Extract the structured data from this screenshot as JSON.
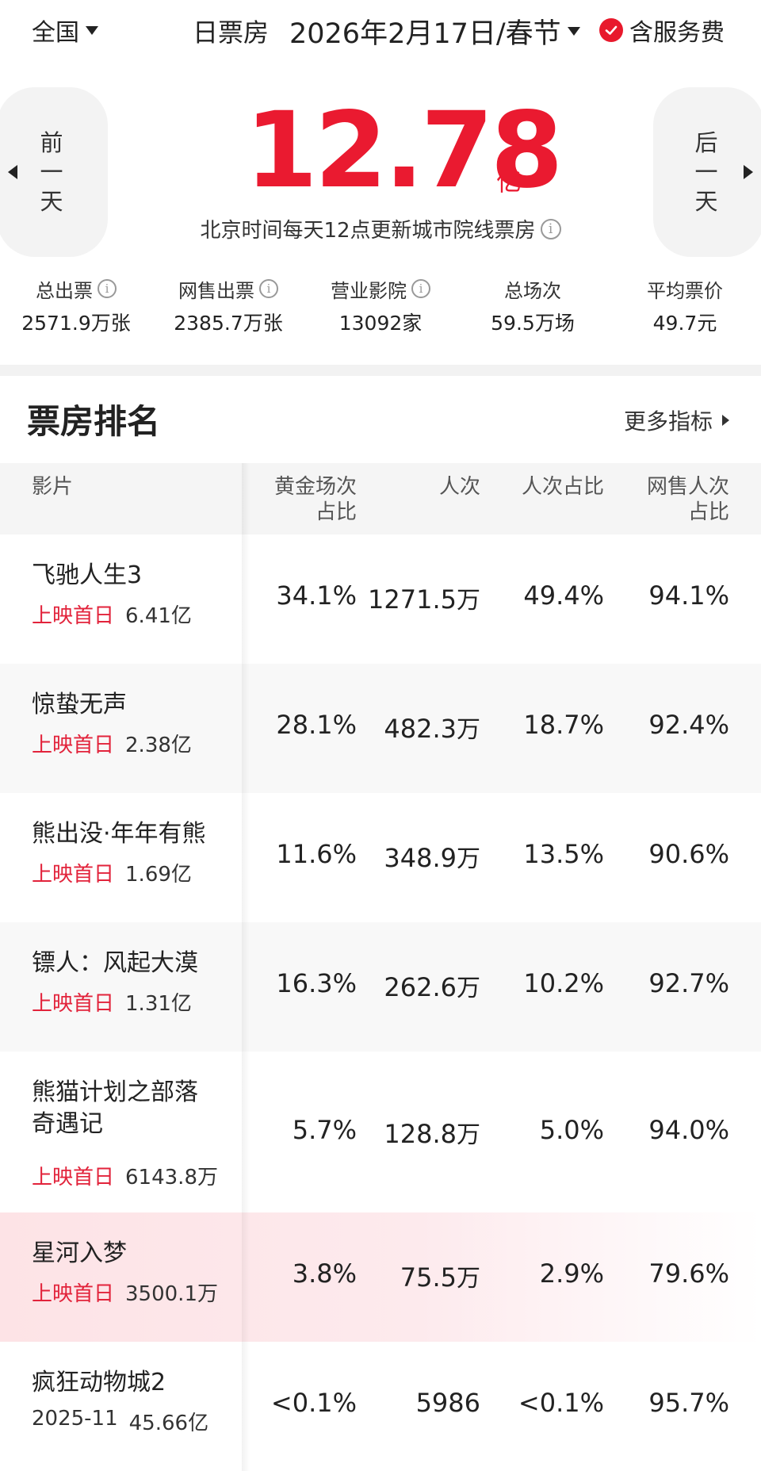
{
  "topbar": {
    "region": "全国",
    "title": "日票房",
    "date": "2026年2月17日/春节",
    "service_fee": "含服务费"
  },
  "hero": {
    "prev_label": [
      "前",
      "一",
      "天"
    ],
    "next_label": [
      "后",
      "一",
      "天"
    ],
    "box_office": "12.78",
    "box_office_unit": "亿",
    "update_note": "北京时间每天12点更新城市院线票房"
  },
  "stats": [
    {
      "label": "总出票",
      "value": "2571.9万张",
      "info": true
    },
    {
      "label": "网售出票",
      "value": "2385.7万张",
      "info": true
    },
    {
      "label": "营业影院",
      "value": "13092家",
      "info": true
    },
    {
      "label": "总场次",
      "value": "59.5万场",
      "info": false
    },
    {
      "label": "平均票价",
      "value": "49.7元",
      "info": false
    }
  ],
  "ranking": {
    "title": "票房排名",
    "more": "更多指标",
    "columns": {
      "film": "影片",
      "golden_ratio": [
        "黄金场次",
        "占比"
      ],
      "attendance": "人次",
      "attendance_ratio": "人次占比",
      "online_ratio": [
        "网售人次",
        "占比"
      ]
    },
    "rows": [
      {
        "name": [
          "飞驰人生3"
        ],
        "tag": "上映首日",
        "tag_red": true,
        "gross": "6.41亿",
        "golden_ratio": "34.1%",
        "attendance": "1271.5",
        "attendance_unit": "万",
        "attendance_ratio": "49.4%",
        "online_ratio": "94.1%"
      },
      {
        "name": [
          "惊蛰无声"
        ],
        "tag": "上映首日",
        "tag_red": true,
        "gross": "2.38亿",
        "golden_ratio": "28.1%",
        "attendance": "482.3",
        "attendance_unit": "万",
        "attendance_ratio": "18.7%",
        "online_ratio": "92.4%"
      },
      {
        "name": [
          "熊出没·年年有熊"
        ],
        "tag": "上映首日",
        "tag_red": true,
        "gross": "1.69亿",
        "golden_ratio": "11.6%",
        "attendance": "348.9",
        "attendance_unit": "万",
        "attendance_ratio": "13.5%",
        "online_ratio": "90.6%"
      },
      {
        "name": [
          "镖人：风起大漠"
        ],
        "tag": "上映首日",
        "tag_red": true,
        "gross": "1.31亿",
        "golden_ratio": "16.3%",
        "attendance": "262.6",
        "attendance_unit": "万",
        "attendance_ratio": "10.2%",
        "online_ratio": "92.7%"
      },
      {
        "name": [
          "熊猫计划之部落",
          "奇遇记"
        ],
        "tag": "上映首日",
        "tag_red": true,
        "gross": "6143.8万",
        "golden_ratio": "5.7%",
        "attendance": "128.8",
        "attendance_unit": "万",
        "attendance_ratio": "5.0%",
        "online_ratio": "94.0%"
      },
      {
        "name": [
          "星河入梦"
        ],
        "tag": "上映首日",
        "tag_red": true,
        "gross": "3500.1万",
        "golden_ratio": "3.8%",
        "attendance": "75.5",
        "attendance_unit": "万",
        "attendance_ratio": "2.9%",
        "online_ratio": "79.6%",
        "highlight": true
      },
      {
        "name": [
          "疯狂动物城2"
        ],
        "tag": "2025-11",
        "tag_red": false,
        "gross": "45.66亿",
        "golden_ratio": "<0.1%",
        "attendance": "5986",
        "attendance_unit": "",
        "attendance_ratio": "<0.1%",
        "online_ratio": "95.7%"
      }
    ]
  },
  "colors": {
    "accent": "#ea1a30",
    "highlight_row": "#fde3e6"
  }
}
